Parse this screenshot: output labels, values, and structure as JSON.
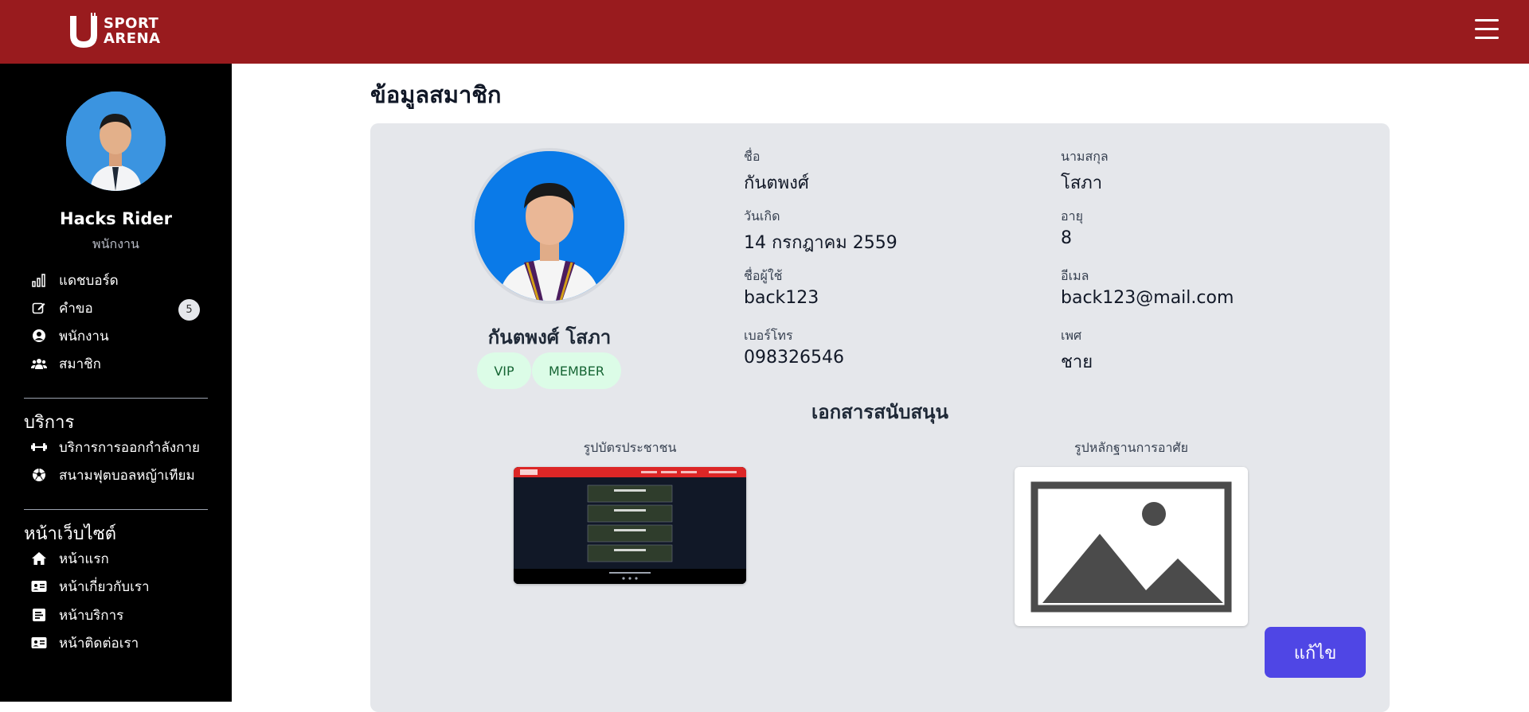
{
  "brand": {
    "logo_line1": "SPORT",
    "logo_line2": "ARENA",
    "accent": "#991b1e"
  },
  "sidebar": {
    "user_name": "Hacks Rider",
    "user_role": "พนักงาน",
    "menu": [
      {
        "label": "แดชบอร์ด",
        "icon": "chart-bar-icon"
      },
      {
        "label": "คำขอ",
        "icon": "edit-icon",
        "badge": "5"
      },
      {
        "label": "พนักงาน",
        "icon": "user-circle-icon"
      },
      {
        "label": "สมาชิก",
        "icon": "users-icon"
      }
    ],
    "services_heading": "บริการ",
    "services": [
      {
        "label": "บริการการออกกำลังกาย",
        "icon": "dumbbell-icon"
      },
      {
        "label": "สนามฟุตบอลหญ้าเทียม",
        "icon": "soccer-ball-icon"
      }
    ],
    "website_heading": "หน้าเว็บไซต์",
    "website": [
      {
        "label": "หน้าแรก",
        "icon": "home-icon"
      },
      {
        "label": "หน้าเกี่ยวกับเรา",
        "icon": "id-card-icon"
      },
      {
        "label": "หน้าบริการ",
        "icon": "list-alt-icon"
      },
      {
        "label": "หน้าติดต่อเรา",
        "icon": "contact-card-icon"
      }
    ]
  },
  "main": {
    "title": "ข้อมูลสมาชิก",
    "profile": {
      "full_name": "กันตพงศ์ โสภา",
      "badges": [
        "VIP",
        "MEMBER"
      ]
    },
    "fields": {
      "first_name_label": "ชื่อ",
      "first_name": "กันตพงศ์",
      "last_name_label": "นามสกุล",
      "last_name": "โสภา",
      "birthdate_label": "วันเกิด",
      "birthdate": "14 กรกฎาคม 2559",
      "age_label": "อายุ",
      "age": "8",
      "username_label": "ชื่อผู้ใช้",
      "username": "back123",
      "email_label": "อีเมล",
      "email": "back123@mail.com",
      "phone_label": "เบอร์โทร",
      "phone": "098326546",
      "gender_label": "เพศ",
      "gender": "ชาย"
    },
    "documents": {
      "title": "เอกสารสนับสนุน",
      "id_card_label": "รูปบัตรประชาชน",
      "residence_label": "รูปหลักฐานการอาศัย"
    },
    "edit_button": "แก้ไข"
  }
}
